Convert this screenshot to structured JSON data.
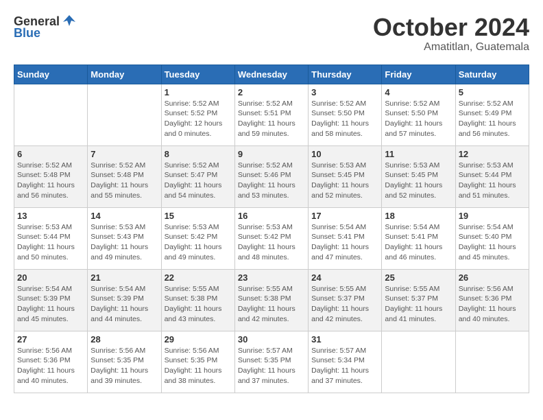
{
  "header": {
    "logo_general": "General",
    "logo_blue": "Blue",
    "month": "October 2024",
    "location": "Amatitlan, Guatemala"
  },
  "days_of_week": [
    "Sunday",
    "Monday",
    "Tuesday",
    "Wednesday",
    "Thursday",
    "Friday",
    "Saturday"
  ],
  "weeks": [
    [
      {
        "num": "",
        "sunrise": "",
        "sunset": "",
        "daylight": ""
      },
      {
        "num": "",
        "sunrise": "",
        "sunset": "",
        "daylight": ""
      },
      {
        "num": "1",
        "sunrise": "Sunrise: 5:52 AM",
        "sunset": "Sunset: 5:52 PM",
        "daylight": "Daylight: 12 hours and 0 minutes."
      },
      {
        "num": "2",
        "sunrise": "Sunrise: 5:52 AM",
        "sunset": "Sunset: 5:51 PM",
        "daylight": "Daylight: 11 hours and 59 minutes."
      },
      {
        "num": "3",
        "sunrise": "Sunrise: 5:52 AM",
        "sunset": "Sunset: 5:50 PM",
        "daylight": "Daylight: 11 hours and 58 minutes."
      },
      {
        "num": "4",
        "sunrise": "Sunrise: 5:52 AM",
        "sunset": "Sunset: 5:50 PM",
        "daylight": "Daylight: 11 hours and 57 minutes."
      },
      {
        "num": "5",
        "sunrise": "Sunrise: 5:52 AM",
        "sunset": "Sunset: 5:49 PM",
        "daylight": "Daylight: 11 hours and 56 minutes."
      }
    ],
    [
      {
        "num": "6",
        "sunrise": "Sunrise: 5:52 AM",
        "sunset": "Sunset: 5:48 PM",
        "daylight": "Daylight: 11 hours and 56 minutes."
      },
      {
        "num": "7",
        "sunrise": "Sunrise: 5:52 AM",
        "sunset": "Sunset: 5:48 PM",
        "daylight": "Daylight: 11 hours and 55 minutes."
      },
      {
        "num": "8",
        "sunrise": "Sunrise: 5:52 AM",
        "sunset": "Sunset: 5:47 PM",
        "daylight": "Daylight: 11 hours and 54 minutes."
      },
      {
        "num": "9",
        "sunrise": "Sunrise: 5:52 AM",
        "sunset": "Sunset: 5:46 PM",
        "daylight": "Daylight: 11 hours and 53 minutes."
      },
      {
        "num": "10",
        "sunrise": "Sunrise: 5:53 AM",
        "sunset": "Sunset: 5:45 PM",
        "daylight": "Daylight: 11 hours and 52 minutes."
      },
      {
        "num": "11",
        "sunrise": "Sunrise: 5:53 AM",
        "sunset": "Sunset: 5:45 PM",
        "daylight": "Daylight: 11 hours and 52 minutes."
      },
      {
        "num": "12",
        "sunrise": "Sunrise: 5:53 AM",
        "sunset": "Sunset: 5:44 PM",
        "daylight": "Daylight: 11 hours and 51 minutes."
      }
    ],
    [
      {
        "num": "13",
        "sunrise": "Sunrise: 5:53 AM",
        "sunset": "Sunset: 5:44 PM",
        "daylight": "Daylight: 11 hours and 50 minutes."
      },
      {
        "num": "14",
        "sunrise": "Sunrise: 5:53 AM",
        "sunset": "Sunset: 5:43 PM",
        "daylight": "Daylight: 11 hours and 49 minutes."
      },
      {
        "num": "15",
        "sunrise": "Sunrise: 5:53 AM",
        "sunset": "Sunset: 5:42 PM",
        "daylight": "Daylight: 11 hours and 49 minutes."
      },
      {
        "num": "16",
        "sunrise": "Sunrise: 5:53 AM",
        "sunset": "Sunset: 5:42 PM",
        "daylight": "Daylight: 11 hours and 48 minutes."
      },
      {
        "num": "17",
        "sunrise": "Sunrise: 5:54 AM",
        "sunset": "Sunset: 5:41 PM",
        "daylight": "Daylight: 11 hours and 47 minutes."
      },
      {
        "num": "18",
        "sunrise": "Sunrise: 5:54 AM",
        "sunset": "Sunset: 5:41 PM",
        "daylight": "Daylight: 11 hours and 46 minutes."
      },
      {
        "num": "19",
        "sunrise": "Sunrise: 5:54 AM",
        "sunset": "Sunset: 5:40 PM",
        "daylight": "Daylight: 11 hours and 45 minutes."
      }
    ],
    [
      {
        "num": "20",
        "sunrise": "Sunrise: 5:54 AM",
        "sunset": "Sunset: 5:39 PM",
        "daylight": "Daylight: 11 hours and 45 minutes."
      },
      {
        "num": "21",
        "sunrise": "Sunrise: 5:54 AM",
        "sunset": "Sunset: 5:39 PM",
        "daylight": "Daylight: 11 hours and 44 minutes."
      },
      {
        "num": "22",
        "sunrise": "Sunrise: 5:55 AM",
        "sunset": "Sunset: 5:38 PM",
        "daylight": "Daylight: 11 hours and 43 minutes."
      },
      {
        "num": "23",
        "sunrise": "Sunrise: 5:55 AM",
        "sunset": "Sunset: 5:38 PM",
        "daylight": "Daylight: 11 hours and 42 minutes."
      },
      {
        "num": "24",
        "sunrise": "Sunrise: 5:55 AM",
        "sunset": "Sunset: 5:37 PM",
        "daylight": "Daylight: 11 hours and 42 minutes."
      },
      {
        "num": "25",
        "sunrise": "Sunrise: 5:55 AM",
        "sunset": "Sunset: 5:37 PM",
        "daylight": "Daylight: 11 hours and 41 minutes."
      },
      {
        "num": "26",
        "sunrise": "Sunrise: 5:56 AM",
        "sunset": "Sunset: 5:36 PM",
        "daylight": "Daylight: 11 hours and 40 minutes."
      }
    ],
    [
      {
        "num": "27",
        "sunrise": "Sunrise: 5:56 AM",
        "sunset": "Sunset: 5:36 PM",
        "daylight": "Daylight: 11 hours and 40 minutes."
      },
      {
        "num": "28",
        "sunrise": "Sunrise: 5:56 AM",
        "sunset": "Sunset: 5:35 PM",
        "daylight": "Daylight: 11 hours and 39 minutes."
      },
      {
        "num": "29",
        "sunrise": "Sunrise: 5:56 AM",
        "sunset": "Sunset: 5:35 PM",
        "daylight": "Daylight: 11 hours and 38 minutes."
      },
      {
        "num": "30",
        "sunrise": "Sunrise: 5:57 AM",
        "sunset": "Sunset: 5:35 PM",
        "daylight": "Daylight: 11 hours and 37 minutes."
      },
      {
        "num": "31",
        "sunrise": "Sunrise: 5:57 AM",
        "sunset": "Sunset: 5:34 PM",
        "daylight": "Daylight: 11 hours and 37 minutes."
      },
      {
        "num": "",
        "sunrise": "",
        "sunset": "",
        "daylight": ""
      },
      {
        "num": "",
        "sunrise": "",
        "sunset": "",
        "daylight": ""
      }
    ]
  ]
}
